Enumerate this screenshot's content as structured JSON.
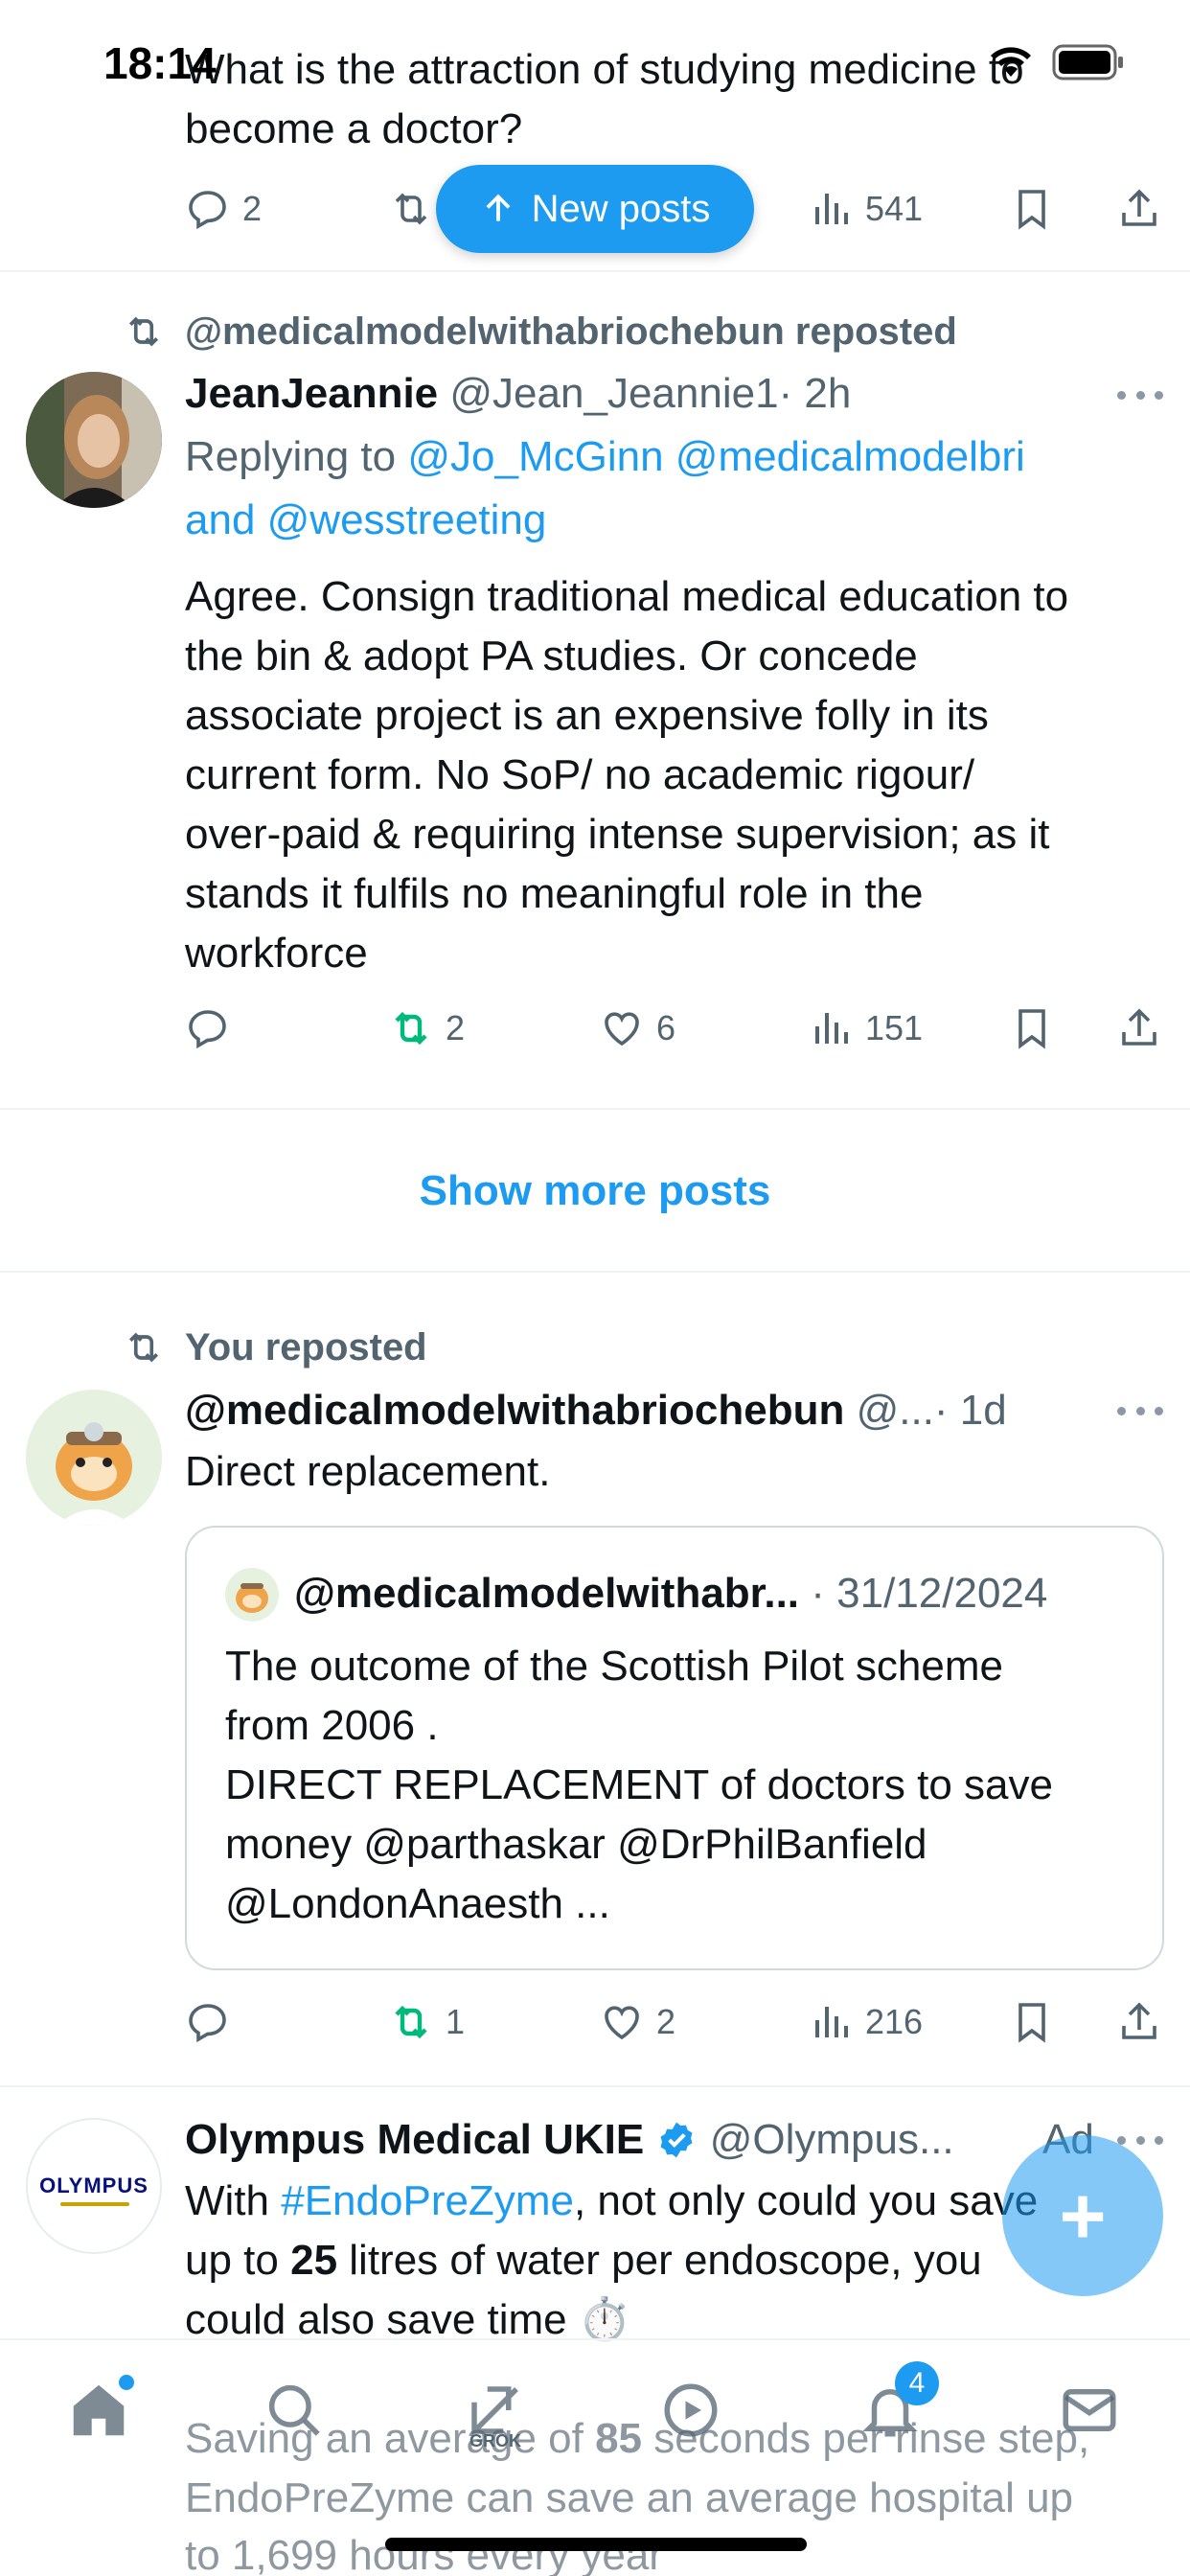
{
  "status_bar": {
    "time": "18:14"
  },
  "top_post": {
    "text": "What is the attraction of studying medicine to become a doctor?",
    "replies": "2",
    "views": "541"
  },
  "new_posts_pill": {
    "label": "New posts"
  },
  "post1": {
    "reposted_by": "@medicalmodelwithabriochebun reposted",
    "name": "JeanJeannie",
    "handle": "@Jean_Jeannie1",
    "time": "· 2h",
    "replying_prefix": "Replying to",
    "replying_line1": "@Jo_McGinn @medicalmodelbri",
    "replying_line2": "and @wesstreeting",
    "lines": [
      "Agree. Consign traditional medical education to",
      "the bin & adopt PA studies. Or concede",
      "associate project is an expensive folly in its",
      "current form. No SoP/ no academic rigour/",
      "over-paid & requiring intense supervision; as it",
      "stands it fulfils no meaningful role in the",
      "workforce"
    ],
    "reposts": "2",
    "likes": "6",
    "views": "151"
  },
  "show_more": {
    "label": "Show more posts"
  },
  "post2": {
    "reposted_by": "You reposted",
    "name": "@medicalmodelwithabriochebun",
    "handle": "@...",
    "time": "· 1d",
    "text": "Direct replacement.",
    "quote": {
      "name": "@medicalmodelwithabr...",
      "date": "· 31/12/2024",
      "lines": [
        "The outcome of the Scottish Pilot scheme",
        "from 2006 .",
        "DIRECT REPLACEMENT of doctors to save",
        "money @parthaskar @DrPhilBanfield",
        "@LondonAnaesth ..."
      ]
    },
    "reposts": "1",
    "likes": "2",
    "views": "216"
  },
  "ad_post": {
    "name": "Olympus Medical UKIE",
    "handle": "@Olympus...",
    "ad_label": "Ad",
    "logo_text": "OLYMPUS",
    "line1_pre": "With ",
    "line1_tag": "#EndoPreZyme",
    "line1_post": ", not only could you save",
    "line2_pre": "up to ",
    "line2_bold": "25",
    "line2_post": " litres of water per endoscope, you",
    "line3": "could also save time ⏱️",
    "line4_pre": "Saving an average of ",
    "line4_bold": "85",
    "line4_post": " seconds per rinse step,",
    "line5": "EndoPreZyme can save an average hospital up",
    "line6": "to 1,699 hours every year"
  },
  "fab": {
    "label": "+"
  },
  "bottom_nav": {
    "notifications_badge": "4",
    "grok_label": "GROK"
  },
  "colors": {
    "accent": "#1d9bf0",
    "repost_green": "#00ba7c",
    "muted": "#536471",
    "separator": "#eff3f4"
  },
  "icons": [
    "reply-icon",
    "repost-icon",
    "like-icon",
    "views-icon",
    "bookmark-icon",
    "share-icon",
    "verified-badge-icon",
    "home-icon",
    "search-icon",
    "grok-icon",
    "video-icon",
    "bell-icon",
    "mail-icon",
    "wifi-icon",
    "battery-icon"
  ]
}
